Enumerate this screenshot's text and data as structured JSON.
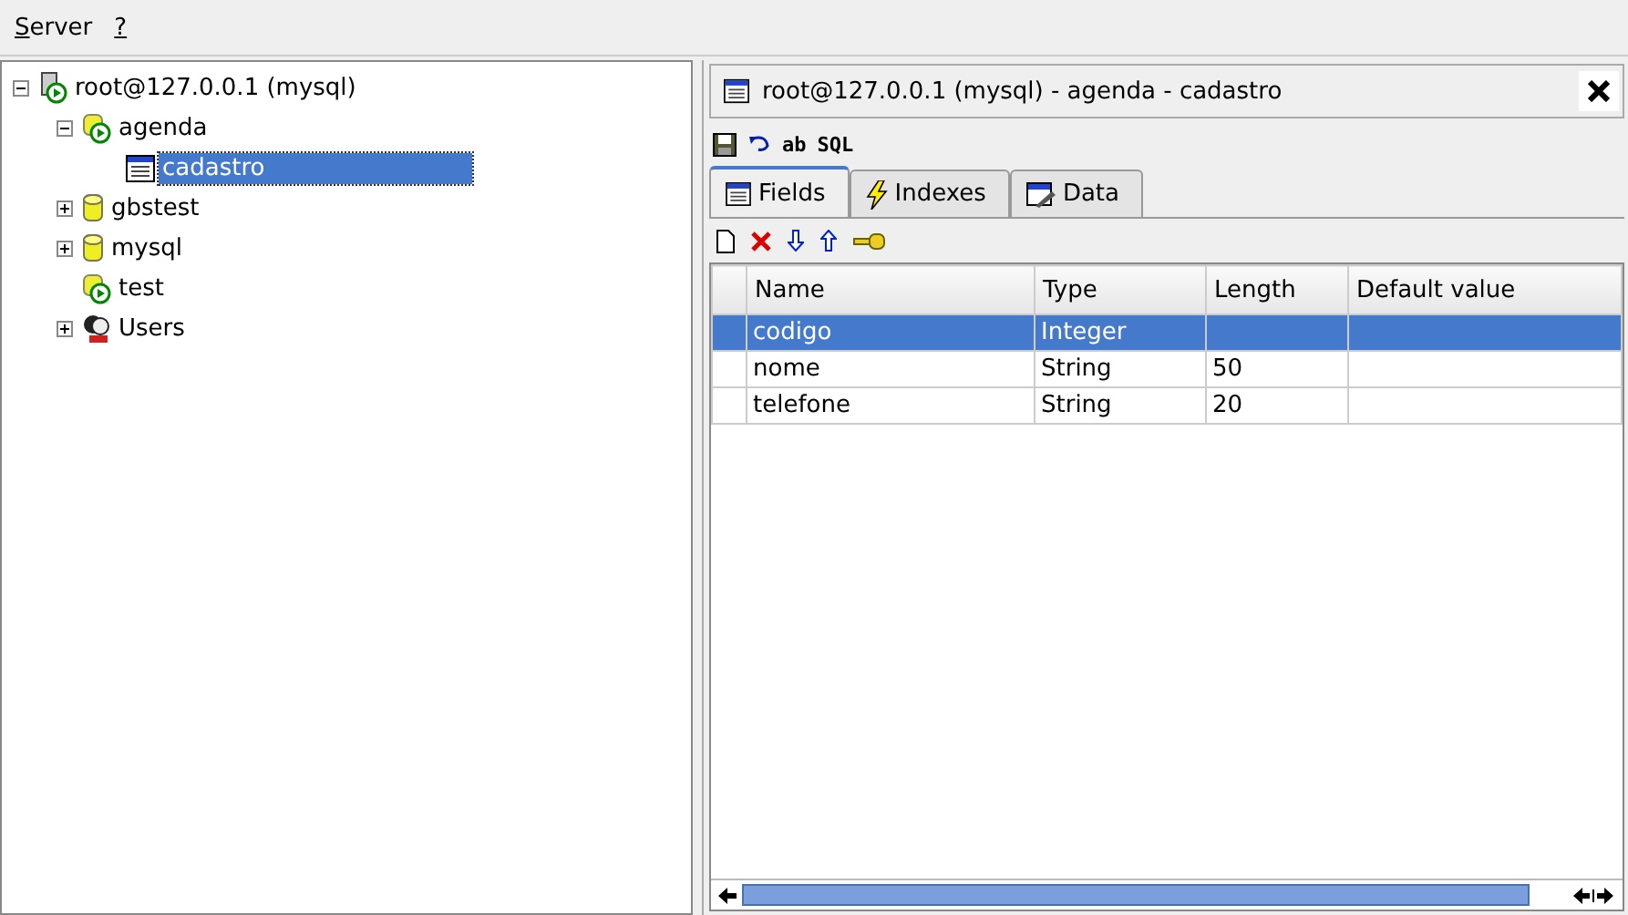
{
  "menu": [
    {
      "label": "Server"
    },
    {
      "label": "?"
    }
  ],
  "tree": [
    {
      "label": "root@127.0.0.1 (mysql)",
      "kind": "server",
      "expanded": true,
      "selected": false,
      "children": [
        {
          "label": "agenda",
          "kind": "database-active",
          "expanded": true,
          "selected": false,
          "children": [
            {
              "label": "cadastro",
              "kind": "table",
              "selected": true
            }
          ]
        },
        {
          "label": "gbstest",
          "kind": "database",
          "expanded": false,
          "selected": false
        },
        {
          "label": "mysql",
          "kind": "database",
          "expanded": false,
          "selected": false
        },
        {
          "label": "test",
          "kind": "database-active",
          "selected": false
        },
        {
          "label": "Users",
          "kind": "users",
          "expanded": false,
          "selected": false
        }
      ]
    }
  ],
  "panel": {
    "title": "root@127.0.0.1 (mysql) - agenda - cadastro",
    "toolbar": [
      {
        "kind": "save"
      },
      {
        "kind": "undo"
      },
      {
        "kind": "text",
        "label": "ab"
      },
      {
        "kind": "text",
        "label": "SQL"
      }
    ],
    "tabs": [
      {
        "label": "Fields",
        "kind": "fields",
        "selected": true
      },
      {
        "label": "Indexes",
        "kind": "indexes",
        "selected": false
      },
      {
        "label": "Data",
        "kind": "data",
        "selected": false
      }
    ],
    "field_toolbar": [
      {
        "kind": "new"
      },
      {
        "kind": "delete"
      },
      {
        "kind": "down"
      },
      {
        "kind": "up"
      },
      {
        "kind": "key"
      }
    ],
    "table": {
      "columns": [
        "Name",
        "Type",
        "Length",
        "Default value"
      ],
      "rows": [
        {
          "cells": [
            "codigo",
            "Integer",
            "",
            ""
          ],
          "selected": true
        },
        {
          "cells": [
            "nome",
            "String",
            "50",
            ""
          ],
          "selected": false
        },
        {
          "cells": [
            "telefone",
            "String",
            "20",
            ""
          ],
          "selected": false
        }
      ]
    }
  }
}
